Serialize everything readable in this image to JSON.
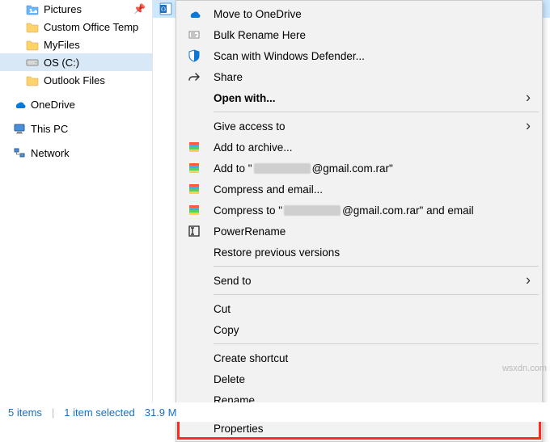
{
  "sidebar": {
    "items": [
      {
        "label": "Pictures",
        "icon": "pictures-folder-icon",
        "pinned": true,
        "indent": 1
      },
      {
        "label": "Custom Office Temp",
        "icon": "folder-icon",
        "indent": 1
      },
      {
        "label": "MyFiles",
        "icon": "folder-icon",
        "indent": 1
      },
      {
        "label": "OS (C:)",
        "icon": "drive-icon",
        "indent": 1,
        "selected": true
      },
      {
        "label": "Outlook Files",
        "icon": "folder-icon",
        "indent": 1
      },
      {
        "label": "OneDrive",
        "icon": "onedrive-icon",
        "indent": 0
      },
      {
        "label": "This PC",
        "icon": "pc-icon",
        "indent": 0
      },
      {
        "label": "Network",
        "icon": "network-icon",
        "indent": 0
      }
    ]
  },
  "file": {
    "icon": "outlook-file-icon"
  },
  "menu": {
    "items": [
      {
        "icon": "onedrive-cloud-icon",
        "label": "Move to OneDrive"
      },
      {
        "icon": "rename-batch-icon",
        "label": "Bulk Rename Here"
      },
      {
        "icon": "defender-shield-icon",
        "label": "Scan with Windows Defender..."
      },
      {
        "icon": "share-icon",
        "label": "Share"
      },
      {
        "spacer": true,
        "label": "Open with...",
        "bold": true,
        "submenu": true
      },
      {
        "sep": true
      },
      {
        "spacer": true,
        "label": "Give access to",
        "submenu": true
      },
      {
        "icon": "winrar-icon",
        "label": "Add to archive..."
      },
      {
        "icon": "winrar-icon",
        "label_prefix": "Add to \"",
        "label_suffix": "@gmail.com.rar\"",
        "redacted": true
      },
      {
        "icon": "winrar-icon",
        "label": "Compress and email..."
      },
      {
        "icon": "winrar-icon",
        "label_prefix": "Compress to \"",
        "label_suffix": "@gmail.com.rar\" and email",
        "redacted": true
      },
      {
        "icon": "powerrename-icon",
        "label": "PowerRename"
      },
      {
        "spacer": true,
        "label": "Restore previous versions"
      },
      {
        "sep": true
      },
      {
        "spacer": true,
        "label": "Send to",
        "submenu": true
      },
      {
        "sep": true
      },
      {
        "spacer": true,
        "label": "Cut"
      },
      {
        "spacer": true,
        "label": "Copy"
      },
      {
        "sep": true
      },
      {
        "spacer": true,
        "label": "Create shortcut"
      },
      {
        "spacer": true,
        "label": "Delete"
      },
      {
        "spacer": true,
        "label": "Rename"
      },
      {
        "sep": true
      },
      {
        "spacer": true,
        "label": "Properties",
        "highlight": true
      }
    ]
  },
  "status": {
    "items_count": "5 items",
    "selected": "1 item selected",
    "size": "31.9 M"
  },
  "watermark": "wsxdn.com"
}
